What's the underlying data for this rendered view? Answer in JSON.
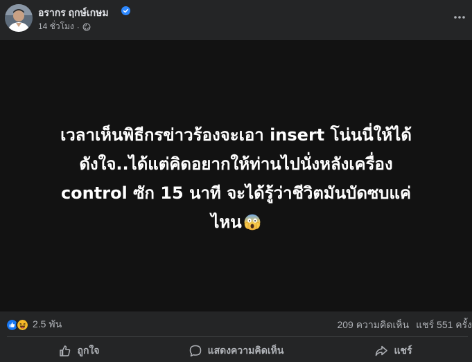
{
  "author": {
    "name": "อรากร ฤกษ์เกษม",
    "verified": true
  },
  "meta": {
    "time": "14 ชั่วโมง",
    "separator": "·",
    "audience_icon": "globe-icon"
  },
  "image": {
    "lines": [
      "เวลาเห็นพิธีกรข่าวร้องจะเอา insert โน่นนี่ให้ได้",
      "ดังใจ..ได้แต่คิดอยากให้ท่านไปนั่งหลังเครื่อง",
      "control ซัก 15 นาที จะได้รู้ว่าชีวิตมันบัดซบแค่",
      "ไหน"
    ],
    "emoji": "face-screaming-in-fear"
  },
  "stats": {
    "reaction_icons": [
      "like-icon",
      "haha-icon"
    ],
    "reactions_count": "2.5 พัน",
    "comments": "209 ความคิดเห็น",
    "shares": "แชร์ 551 ครั้ง"
  },
  "actions": {
    "like": "ถูกใจ",
    "comment": "แสดงความคิดเห็น",
    "share": "แชร์"
  },
  "colors": {
    "background": "#242526",
    "image_background": "#121212",
    "primary_text": "#e4e6eb",
    "secondary_text": "#b0b3b8",
    "verified": "#2d88ff",
    "like": "#1877f2",
    "haha": "#f7b928"
  }
}
